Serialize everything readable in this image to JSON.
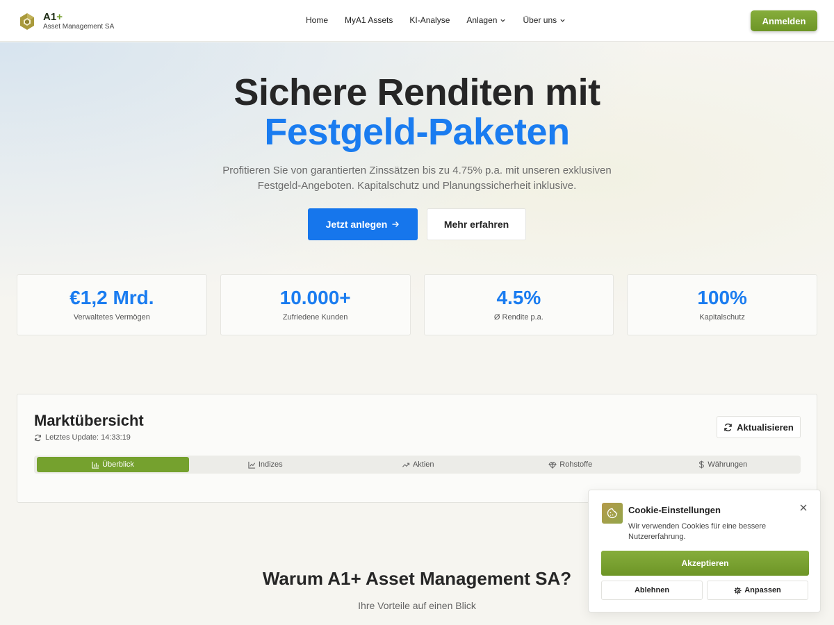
{
  "header": {
    "brand": "A1",
    "brand_plus": "+",
    "brand_sub": "Asset Management SA",
    "nav": [
      {
        "label": "Home"
      },
      {
        "label": "MyA1 Assets"
      },
      {
        "label": "KI-Analyse"
      },
      {
        "label": "Anlagen"
      },
      {
        "label": "Über uns"
      }
    ],
    "login_label": "Anmelden"
  },
  "hero": {
    "title_line1": "Sichere Renditen mit",
    "title_line2": "Festgeld-Paketen",
    "subtitle": "Profitieren Sie von garantierten Zinssätzen bis zu 4.75% p.a. mit unseren exklusiven Festgeld-Angeboten. Kapitalschutz und Planungssicherheit inklusive.",
    "primary_label": "Jetzt anlegen",
    "secondary_label": "Mehr erfahren"
  },
  "stats": [
    {
      "value": "€1,2 Mrd.",
      "label": "Verwaltetes Vermögen"
    },
    {
      "value": "10.000+",
      "label": "Zufriedene Kunden"
    },
    {
      "value": "4.5%",
      "label": "Ø Rendite p.a."
    },
    {
      "value": "100%",
      "label": "Kapitalschutz"
    }
  ],
  "market": {
    "title": "Marktübersicht",
    "last_update": "Letztes Update: 14:33:19",
    "refresh_label": "Aktualisieren",
    "tabs": [
      {
        "label": "Überblick",
        "active": true
      },
      {
        "label": "Indizes"
      },
      {
        "label": "Aktien"
      },
      {
        "label": "Rohstoffe"
      },
      {
        "label": "Währungen"
      }
    ]
  },
  "why": {
    "title": "Warum A1+ Asset Management SA?",
    "subtitle": "Ihre Vorteile auf einen Blick"
  },
  "cookie": {
    "title": "Cookie-Einstellungen",
    "text": "Wir verwenden Cookies für eine bessere Nutzererfahrung.",
    "accept_label": "Akzeptieren",
    "decline_label": "Ablehnen",
    "customize_label": "Anpassen"
  },
  "colors": {
    "accent_blue": "#1a7cf0",
    "accent_green": "#75a12e"
  }
}
